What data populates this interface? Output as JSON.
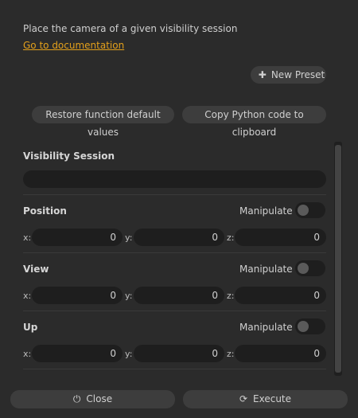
{
  "description": "Place the camera of a given visibility session",
  "doc_link": "Go to documentation",
  "buttons": {
    "new_preset": "New Preset",
    "restore": "Restore function default values",
    "copy": "Copy Python code to clipboard",
    "close": "Close",
    "execute": "Execute"
  },
  "visibility_session": {
    "label": "Visibility Session",
    "value": ""
  },
  "sections": [
    {
      "label": "Position",
      "manipulate": "Manipulate",
      "x": "0",
      "y": "0",
      "z": "0"
    },
    {
      "label": "View",
      "manipulate": "Manipulate",
      "x": "0",
      "y": "0",
      "z": "0"
    },
    {
      "label": "Up",
      "manipulate": "Manipulate",
      "x": "0",
      "y": "0",
      "z": "0"
    }
  ],
  "axis_labels": {
    "x": "x:",
    "y": "y:",
    "z": "z:"
  },
  "icons": {
    "new_preset": "plus-icon",
    "close": "power-icon",
    "execute": "refresh-icon"
  },
  "colors": {
    "link": "#e3a01b",
    "background": "#2b2b2b"
  }
}
